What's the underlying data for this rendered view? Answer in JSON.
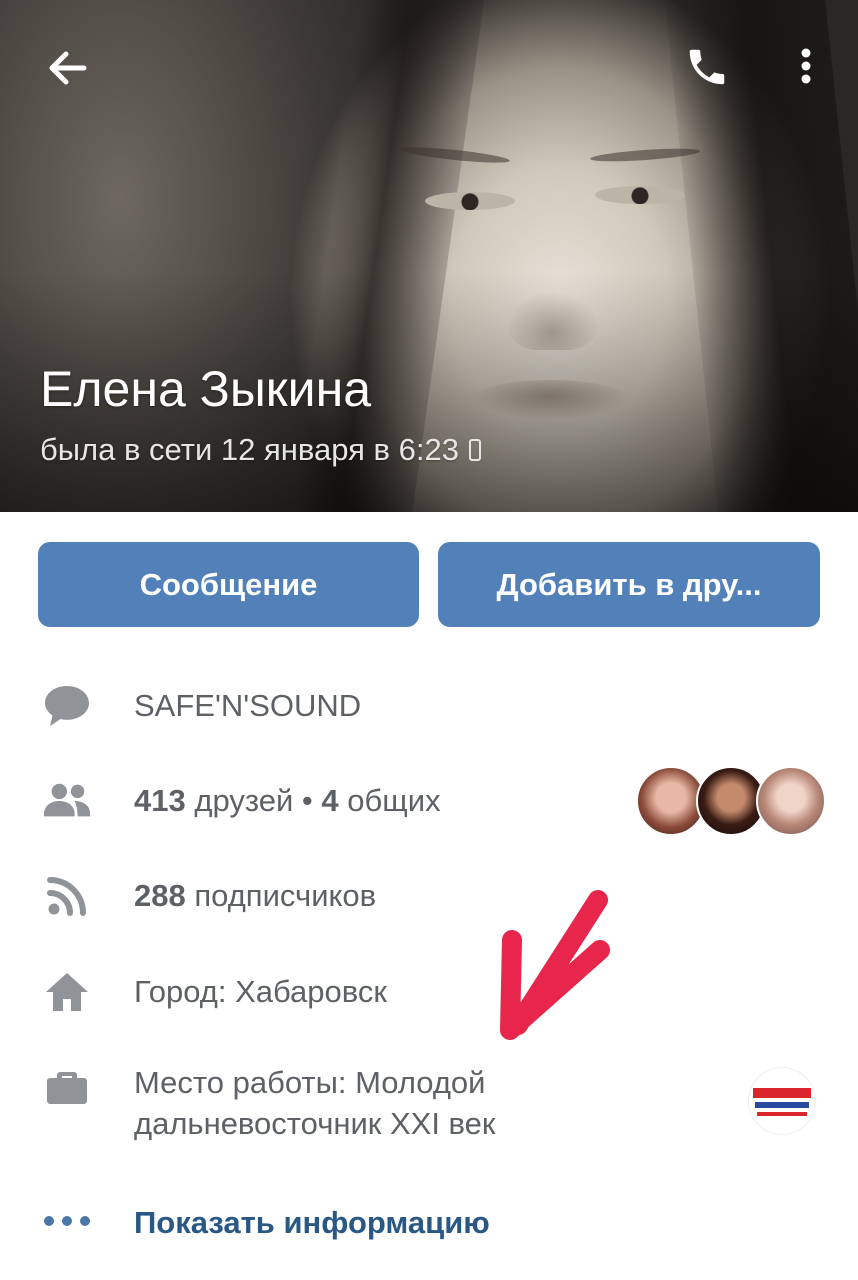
{
  "profile": {
    "name": "Елена Зыкина",
    "status": "была в сети 12 января в 6:23"
  },
  "actions": {
    "message": "Сообщение",
    "add_friend": "Добавить в дру..."
  },
  "info": {
    "status_text": "SAFE'N'SOUND",
    "friends_count": "413",
    "friends_label": "друзей",
    "separator": "•",
    "mutual_count": "4",
    "mutual_label": "общих",
    "followers_count": "288",
    "followers_label": "подписчиков",
    "city": "Город: Хабаровск",
    "work_line1": "Место работы: Молодой",
    "work_line2": "дальневосточник XXI век",
    "show_info": "Показать информацию"
  },
  "colors": {
    "accent": "#5181b8",
    "link": "#2a5885",
    "icon_gray": "#909499",
    "arrow": "#e8264b"
  }
}
